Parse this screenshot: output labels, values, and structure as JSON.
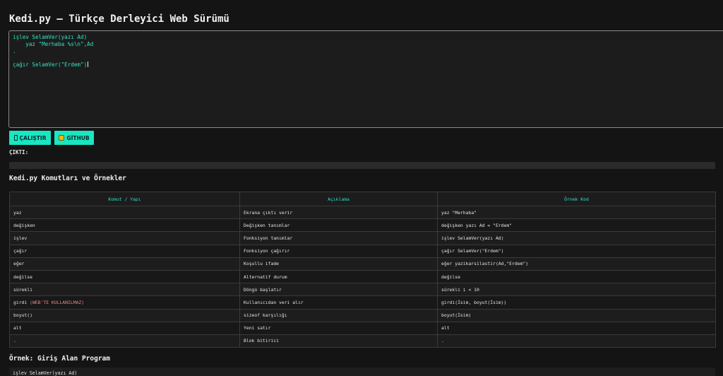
{
  "header": {
    "title": "Kedi.py — Türkçe Derleyici Web Sürümü"
  },
  "editor": {
    "lines": [
      "işlev SelamVer(yazı Ad)",
      "    yaz \"Merhaba %s\\n\",Ad",
      ".",
      "",
      "çağır SelamVer(\"Erdem\")"
    ]
  },
  "buttons": {
    "run_label": "ÇALIŞTIR",
    "github_label": "GİTHUB"
  },
  "output": {
    "label": "ÇIKTI:",
    "value": ""
  },
  "commands_section": {
    "title": "Kedi.py Komutları ve Örnekler",
    "columns": [
      "Komut / Yapı",
      "Açıklama",
      "Örnek Kod"
    ],
    "rows": [
      {
        "cmd": "yaz",
        "note": "",
        "desc": "Ekrana çıktı verir",
        "example": "yaz \"Merhaba\""
      },
      {
        "cmd": "değişken",
        "note": "",
        "desc": "Değişken tanımlar",
        "example": "değişken yazı Ad = \"Erdem\""
      },
      {
        "cmd": "işlev",
        "note": "",
        "desc": "Fonksiyon tanımlar",
        "example": "işlev SelamVer(yazı Ad)"
      },
      {
        "cmd": "çağır",
        "note": "",
        "desc": "Fonksiyon çağırır",
        "example": "çağır SelamVer(\"Erdem\")"
      },
      {
        "cmd": "eğer",
        "note": "",
        "desc": "Koşullu ifade",
        "example": "eğer yazikarsilastir(Ad,\"Erdem\")"
      },
      {
        "cmd": "değilse",
        "note": "",
        "desc": "Alternatif durum",
        "example": "değilse"
      },
      {
        "cmd": "sürekli",
        "note": "",
        "desc": "Döngü başlatır",
        "example": "sürekli i < 10"
      },
      {
        "cmd": "girdi",
        "note": "(WEB'TE KULLANILMAZ)",
        "desc": "Kullanıcıdan veri alır",
        "example": "girdi(İsim, boyut(İsim))"
      },
      {
        "cmd": "boyut()",
        "note": "",
        "desc": "sizeof karşılığı",
        "example": "boyut(İsim)"
      },
      {
        "cmd": "alt",
        "note": "",
        "desc": "Yeni satır",
        "example": "alt"
      },
      {
        "cmd": ".",
        "note": "",
        "desc": "Blok bitirici",
        "example": "."
      }
    ]
  },
  "example_section": {
    "title": "Örnek: Giriş Alan Program",
    "first_line": "işlev SelamVer(yazı Ad)"
  },
  "colors": {
    "accent": "#19e6c2",
    "code": "#34e0c0",
    "background": "#141414",
    "warning": "#e88a8a"
  }
}
